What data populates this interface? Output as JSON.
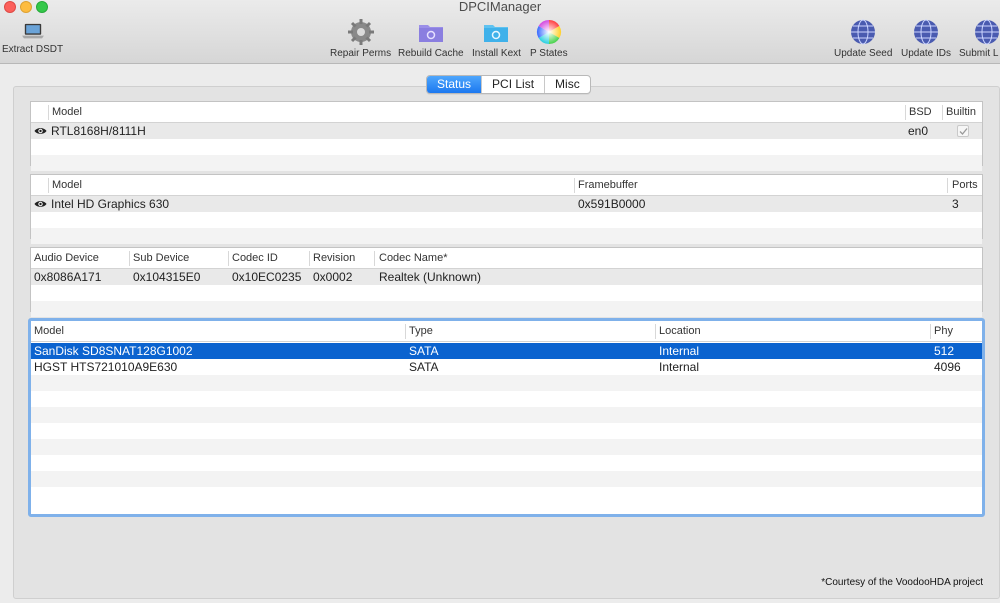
{
  "window": {
    "title": "DPCIManager"
  },
  "toolbar": {
    "extract_dsdt": "Extract DSDT",
    "repair_perms": "Repair Perms",
    "rebuild_cache": "Rebuild Cache",
    "install_kext": "Install Kext",
    "p_states": "P States",
    "update_seed": "Update Seed",
    "update_ids": "Update IDs",
    "submit": "Submit L"
  },
  "tabs": {
    "status": "Status",
    "pci_list": "PCI List",
    "misc": "Misc",
    "active": "Status"
  },
  "network": {
    "headers": {
      "model": "Model",
      "bsd": "BSD",
      "builtin": "Builtin"
    },
    "rows": [
      {
        "model": "RTL8168H/8111H",
        "bsd": "en0",
        "builtin": true
      }
    ]
  },
  "graphics": {
    "headers": {
      "model": "Model",
      "framebuffer": "Framebuffer",
      "ports": "Ports"
    },
    "rows": [
      {
        "model": "Intel HD Graphics 630",
        "framebuffer": "0x591B0000",
        "ports": "3"
      }
    ]
  },
  "audio": {
    "headers": {
      "audio_device": "Audio Device",
      "sub_device": "Sub Device",
      "codec_id": "Codec ID",
      "revision": "Revision",
      "codec_name": "Codec Name*"
    },
    "rows": [
      {
        "audio_device": "0x8086A171",
        "sub_device": "0x104315E0",
        "codec_id": "0x10EC0235",
        "revision": "0x0002",
        "codec_name": "Realtek (Unknown)"
      }
    ]
  },
  "storage": {
    "headers": {
      "model": "Model",
      "type": "Type",
      "location": "Location",
      "phy_block": "Phy Block"
    },
    "rows": [
      {
        "model": "SanDisk SD8SNAT128G1002",
        "type": "SATA",
        "location": "Internal",
        "phy_block": "512",
        "selected": true
      },
      {
        "model": "HGST HTS721010A9E630",
        "type": "SATA",
        "location": "Internal",
        "phy_block": "4096",
        "selected": false
      }
    ]
  },
  "footer": {
    "credit": "*Courtesy of the VoodooHDA project"
  },
  "colors": {
    "accent": "#1b78f0",
    "selection": "#0b63cf",
    "focus_ring": "#7fb1ea"
  }
}
